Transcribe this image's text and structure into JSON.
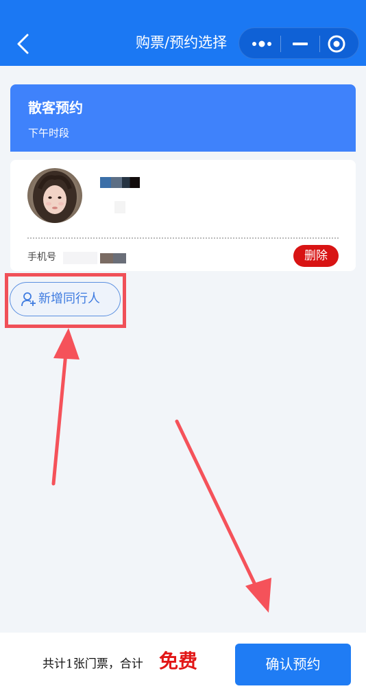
{
  "header": {
    "title": "购票/预约选择",
    "background_color": "#1b78f3",
    "icons": [
      "back-chevron-icon",
      "more-dots-icon",
      "minimize-icon",
      "close-target-icon"
    ]
  },
  "ticket": {
    "title": "散客预约",
    "subtitle": "下午时段",
    "color": "#3f82fb"
  },
  "visitor": {
    "phone_label": "手机号",
    "delete_label": "删除",
    "delete_color": "#d81414"
  },
  "add_companion": {
    "label": "新增同行人",
    "icon": "add-user-icon"
  },
  "footer": {
    "summary": "共计1张门票，合计",
    "price": "免费",
    "confirm_label": "确认预约",
    "price_color": "#e21717"
  },
  "annotations": {
    "highlight_color": "#f05058",
    "arrow_color": "#f5525a"
  }
}
